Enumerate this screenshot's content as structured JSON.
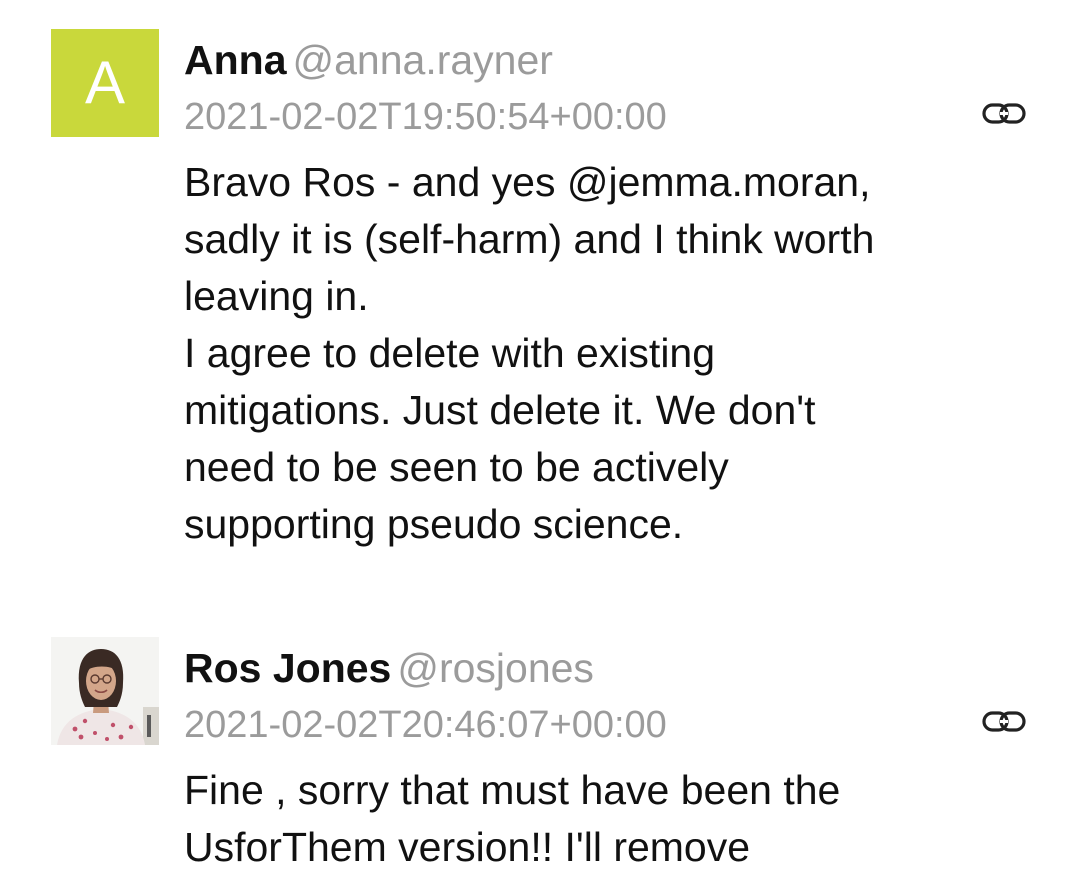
{
  "comments": [
    {
      "avatar_letter": "A",
      "avatar_color": "#c9d83b",
      "display_name": "Anna",
      "handle": "@anna.rayner",
      "timestamp": "2021-02-02T19:50:54+00:00",
      "permalink_icon": "link-icon",
      "body_lines": [
        "Bravo Ros - and yes @jemma.moran,",
        "sadly it is (self-harm) and I think worth",
        "leaving in.",
        "I agree to delete with existing",
        "mitigations. Just delete it. We don't",
        "need to be seen to be actively",
        "supporting pseudo science."
      ]
    },
    {
      "avatar_image": "profile-photo",
      "display_name": "Ros Jones",
      "handle": "@rosjones",
      "timestamp": "2021-02-02T20:46:07+00:00",
      "permalink_icon": "link-icon",
      "body_lines": [
        "Fine , sorry that must have been the",
        "UsforThem version!! I'll remove"
      ]
    }
  ]
}
